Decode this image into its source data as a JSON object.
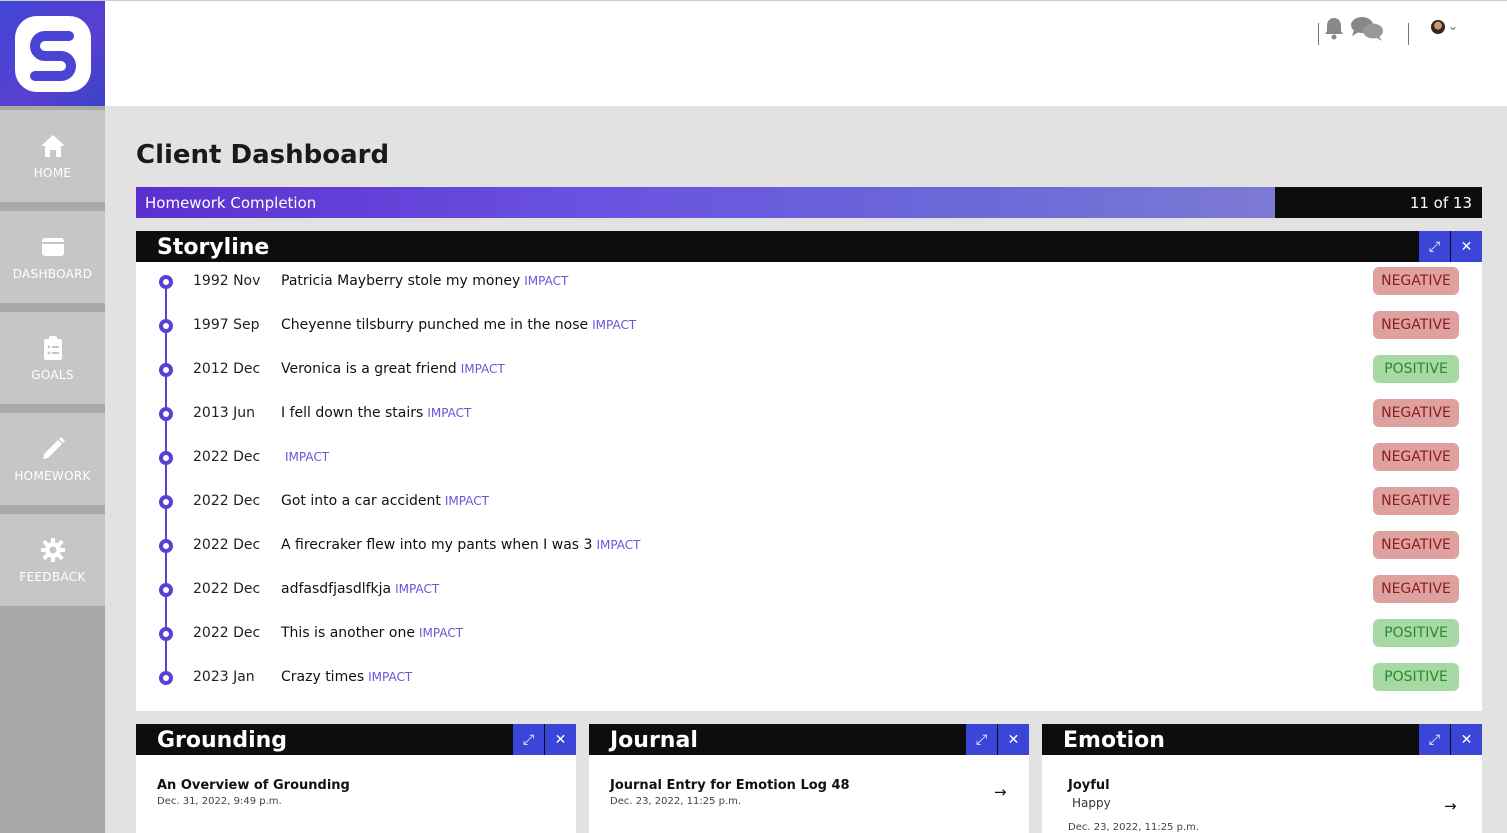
{
  "nav": {
    "items": [
      {
        "label": "HOME",
        "icon": "home-icon"
      },
      {
        "label": "DASHBOARD",
        "icon": "dashboard-icon"
      },
      {
        "label": "GOALS",
        "icon": "clipboard-icon"
      },
      {
        "label": "HOMEWORK",
        "icon": "pencil-icon"
      },
      {
        "label": "FEEDBACK",
        "icon": "gear-icon"
      }
    ]
  },
  "page": {
    "title": "Client Dashboard"
  },
  "homework": {
    "label": "Homework Completion",
    "count": "11 of 13",
    "completed": 11,
    "total": 13
  },
  "storyline": {
    "title": "Storyline",
    "impact_label": "IMPACT",
    "events": [
      {
        "date": "1992 Nov",
        "text": "Patricia Mayberry stole my money",
        "impact": "NEGATIVE"
      },
      {
        "date": "1997 Sep",
        "text": "Cheyenne tilsburry punched me in the nose",
        "impact": "NEGATIVE"
      },
      {
        "date": "2012 Dec",
        "text": "Veronica is a great friend",
        "impact": "POSITIVE"
      },
      {
        "date": "2013 Jun",
        "text": "I fell down the stairs",
        "impact": "NEGATIVE"
      },
      {
        "date": "2022 Dec",
        "text": "",
        "impact": "NEGATIVE"
      },
      {
        "date": "2022 Dec",
        "text": "Got into a car accident",
        "impact": "NEGATIVE"
      },
      {
        "date": "2022 Dec",
        "text": "A firecraker flew into my pants when I was 3",
        "impact": "NEGATIVE"
      },
      {
        "date": "2022 Dec",
        "text": "adfasdfjasdlfkja",
        "impact": "NEGATIVE"
      },
      {
        "date": "2022 Dec",
        "text": "This is another one",
        "impact": "POSITIVE"
      },
      {
        "date": "2023 Jan",
        "text": "Crazy times",
        "impact": "POSITIVE"
      }
    ]
  },
  "grounding": {
    "title": "Grounding",
    "entry_title": "An Overview of Grounding",
    "entry_date": "Dec. 31, 2022, 9:49 p.m."
  },
  "journal": {
    "title": "Journal",
    "entry_title": "Journal Entry for Emotion Log 48",
    "entry_date": "Dec. 23, 2022, 11:25 p.m."
  },
  "emotion": {
    "title": "Emotion",
    "entry_title": "Joyful",
    "entry_sub": "Happy",
    "entry_date": "Dec. 23, 2022, 11:25 p.m."
  },
  "colors": {
    "accent": "#3b45d8",
    "timeline": "#5b3fd6",
    "negative_bg": "#dfa0a0",
    "positive_bg": "#a6d9a4",
    "header_bg": "#0d0d10"
  }
}
